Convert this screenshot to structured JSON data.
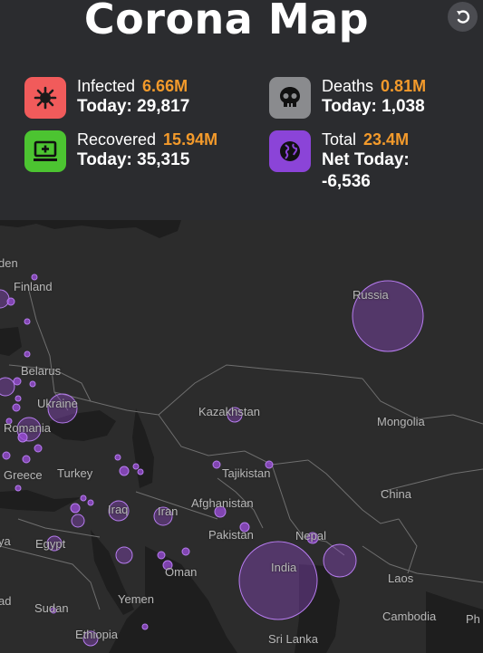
{
  "app": {
    "title": "Corona Map"
  },
  "stats": {
    "infected": {
      "label": "Infected",
      "value": "6.66M",
      "today": "Today: 29,817",
      "color": "#f15b5b",
      "icon": "virus-icon"
    },
    "deaths": {
      "label": "Deaths",
      "value": "0.81M",
      "today": "Today: 1,038",
      "color": "#8a8b8e",
      "icon": "skull-icon"
    },
    "recovered": {
      "label": "Recovered",
      "value": "15.94M",
      "today": "Today: 35,315",
      "color": "#4cc431",
      "icon": "monitor-plus-icon"
    },
    "total": {
      "label": "Total",
      "value": "23.4M",
      "today_line1": "Net Today:",
      "today_line2": "-6,536",
      "color": "#8b44d8",
      "icon": "globe-icon"
    }
  },
  "map": {
    "countries": [
      {
        "name": "den"
      },
      {
        "name": "Finland"
      },
      {
        "name": "Russia"
      },
      {
        "name": "Belarus"
      },
      {
        "name": "Ukraine"
      },
      {
        "name": "Romania"
      },
      {
        "name": "Kazakhstan"
      },
      {
        "name": "Mongolia"
      },
      {
        "name": "Greece"
      },
      {
        "name": "Turkey"
      },
      {
        "name": "Tajikistan"
      },
      {
        "name": "China"
      },
      {
        "name": "Iraq"
      },
      {
        "name": "Iran"
      },
      {
        "name": "Afghanistan"
      },
      {
        "name": "ya"
      },
      {
        "name": "Egypt"
      },
      {
        "name": "Pakistan"
      },
      {
        "name": "Nepal"
      },
      {
        "name": "Oman"
      },
      {
        "name": "India"
      },
      {
        "name": "Laos"
      },
      {
        "name": "ad"
      },
      {
        "name": "Sudan"
      },
      {
        "name": "Yemen"
      },
      {
        "name": "Cambodia"
      },
      {
        "name": "Ph"
      },
      {
        "name": "Ethiopia"
      },
      {
        "name": "Sri Lanka"
      }
    ],
    "bubble_color": "#9d4edd"
  }
}
